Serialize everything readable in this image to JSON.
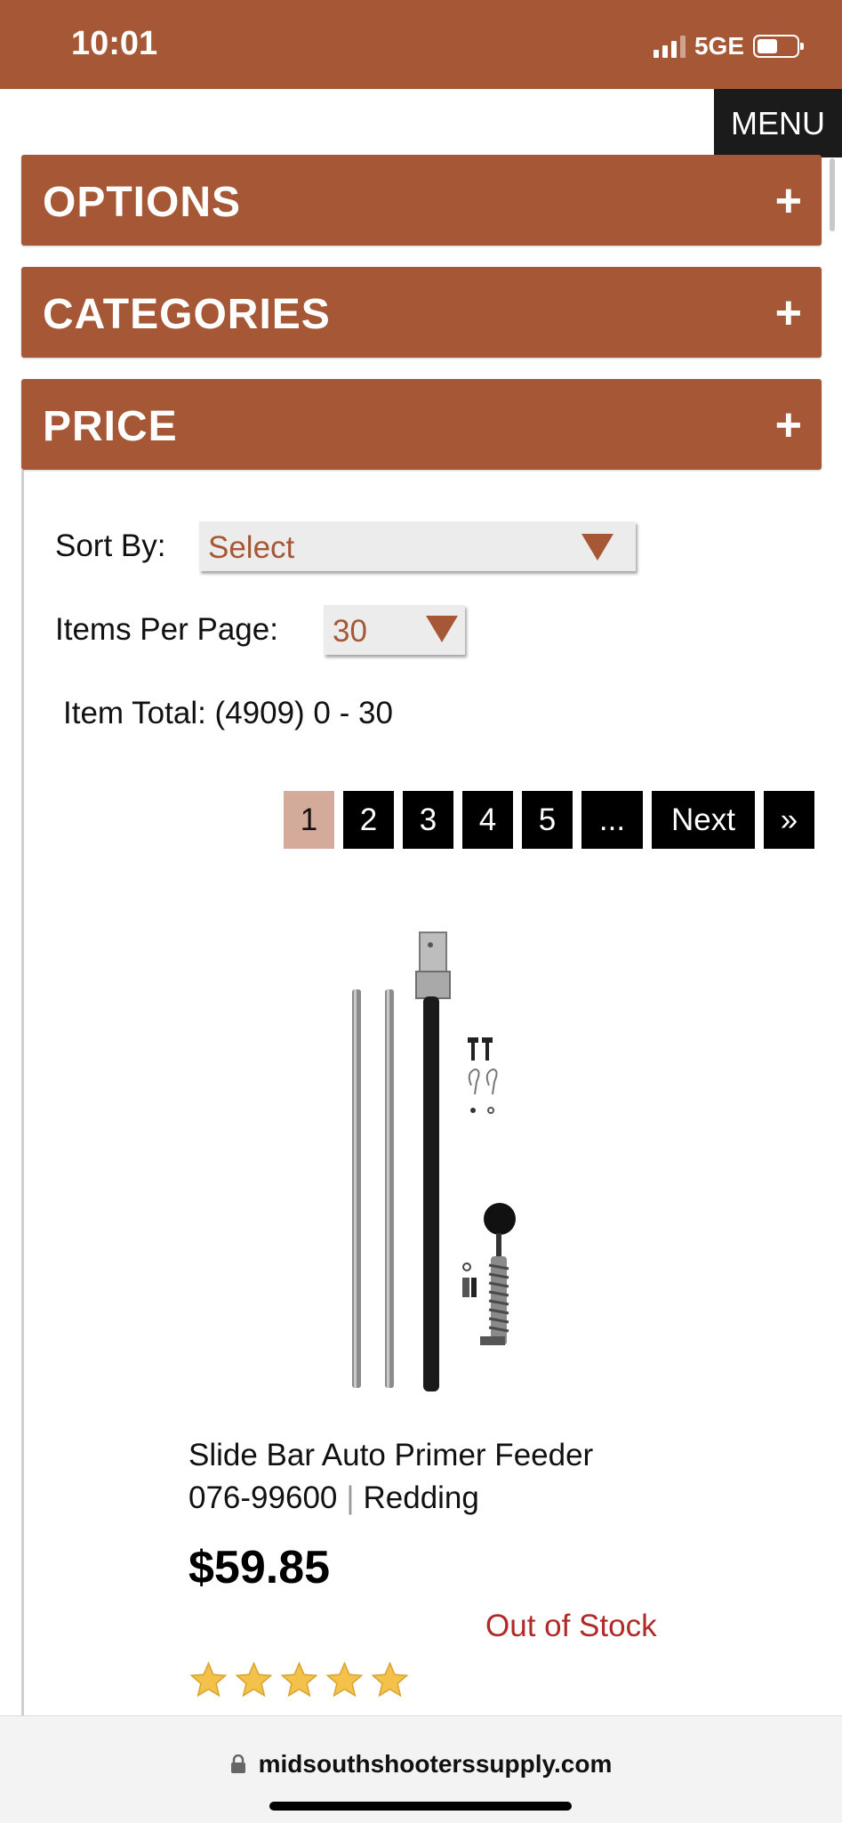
{
  "status_bar": {
    "time": "10:01",
    "network": "5GE"
  },
  "menu": {
    "label": "MENU"
  },
  "accordions": [
    {
      "label": "OPTIONS",
      "icon": "+"
    },
    {
      "label": "CATEGORIES",
      "icon": "+"
    },
    {
      "label": "PRICE",
      "icon": "+"
    }
  ],
  "sort": {
    "label": "Sort By:",
    "value": "Select"
  },
  "per_page": {
    "label": "Items Per Page:",
    "value": "30"
  },
  "item_total": "Item Total: (4909) 0 - 30",
  "pagination": {
    "pages": [
      "1",
      "2",
      "3",
      "4",
      "5",
      "..."
    ],
    "active": "1",
    "next": "Next",
    "last": "»"
  },
  "product": {
    "name": "Slide Bar Auto Primer Feeder",
    "sku": "076-99600",
    "separator": "|",
    "brand": "Redding",
    "price": "$59.85",
    "stock": "Out of Stock",
    "rating": 5,
    "rating_max": 5
  },
  "browser": {
    "url": "midsouthshooterssupply.com"
  },
  "colors": {
    "brand": "#a65836",
    "active_page": "#d4ab9b",
    "stock": "#b02a2a",
    "star": "#f4c24a"
  }
}
